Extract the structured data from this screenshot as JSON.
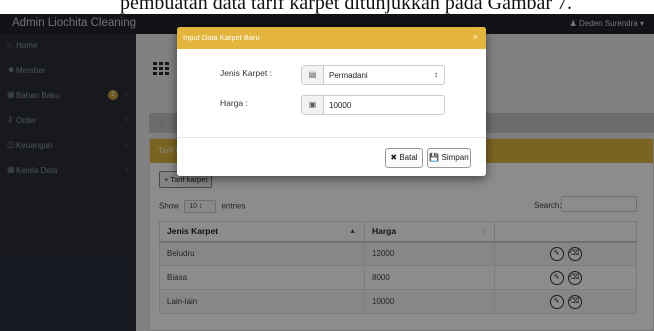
{
  "caption": {
    "text": "pembuatan data tarif karpet ditunjukkan pada Gambar 7."
  },
  "navbar": {
    "brand": "Admin Liochita Cleaning",
    "user": "Deden Surendra",
    "user_icon": "user-icon",
    "caret": "▾"
  },
  "sidebar": {
    "items": [
      {
        "label": "Home",
        "icon": "home-icon"
      },
      {
        "label": "Member",
        "icon": "users-icon"
      },
      {
        "label": "Bahan Baku",
        "icon": "box-icon",
        "badge": "1"
      },
      {
        "label": "Order",
        "icon": "cart-icon"
      },
      {
        "label": "Keuangan",
        "icon": "money-icon"
      },
      {
        "label": "Kelola Data",
        "icon": "grid-icon"
      }
    ]
  },
  "content": {
    "panel_title": "Tarif Karpet",
    "add_button": "+ Tarif karpet",
    "show_label": "Show",
    "entries_value": "10",
    "entries_label": "entries",
    "search_label": "Search:",
    "table": {
      "headers": [
        "Jenis Karpet",
        "Harga",
        ""
      ],
      "rows": [
        {
          "jenis": "Beludru",
          "harga": "12000"
        },
        {
          "jenis": "Biasa",
          "harga": "8000"
        },
        {
          "jenis": "Lain-lain",
          "harga": "10000"
        }
      ]
    }
  },
  "modal": {
    "title": "Input Data Karpet Baru",
    "close": "×",
    "jenis_label": "Jenis Karpet :",
    "jenis_value": "Permadani",
    "harga_label": "Harga :",
    "harga_value": "10000",
    "batal_label": "✖ Batal",
    "simpan_label": "Simpan"
  },
  "colors": {
    "accent": "#e4b53d",
    "navbar": "#22222a",
    "sidebar": "#2a2f3a"
  }
}
